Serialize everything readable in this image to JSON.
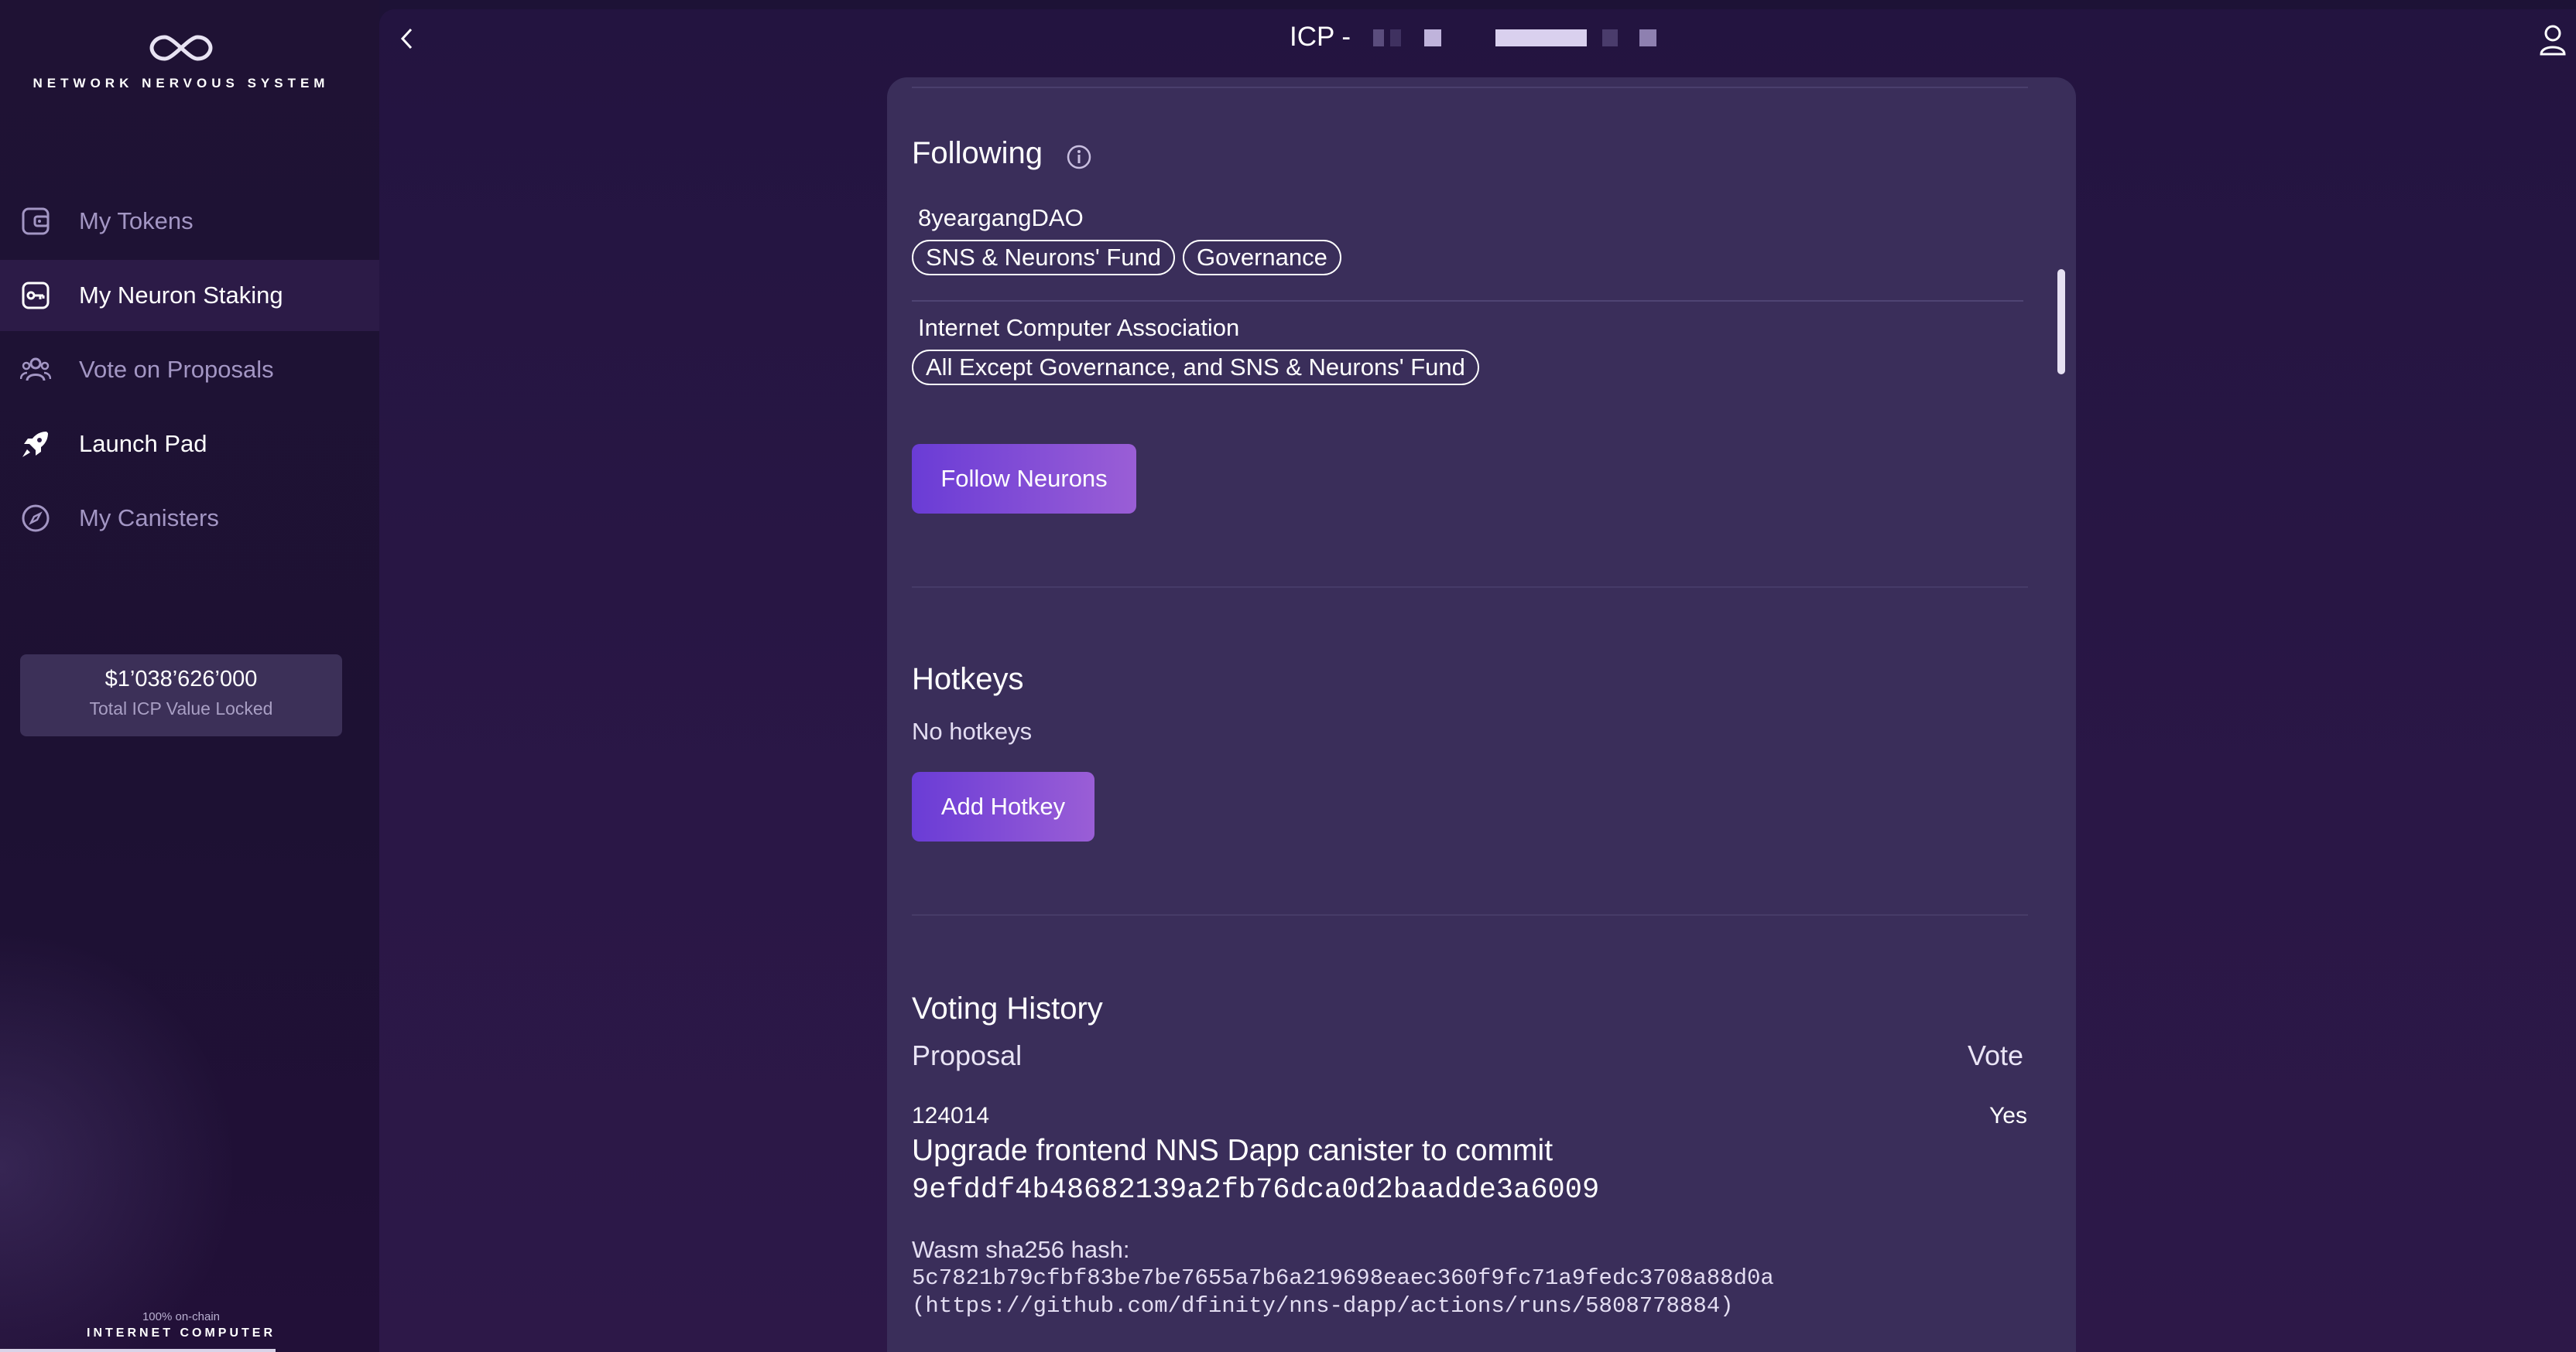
{
  "sidebar": {
    "logo_text": "NETWORK NERVOUS SYSTEM",
    "items": [
      {
        "label": "My Tokens",
        "icon": "wallet-icon"
      },
      {
        "label": "My Neuron Staking",
        "icon": "neuron-icon"
      },
      {
        "label": "Vote on Proposals",
        "icon": "users-icon"
      },
      {
        "label": "Launch Pad",
        "icon": "rocket-icon"
      },
      {
        "label": "My Canisters",
        "icon": "compass-icon"
      }
    ],
    "tvl": {
      "value": "$1’038’626’000",
      "label": "Total ICP Value Locked"
    },
    "footer": {
      "small": "100% on-chain",
      "big": "INTERNET COMPUTER"
    }
  },
  "header": {
    "title": "ICP -"
  },
  "following": {
    "title": "Following",
    "followees": [
      {
        "name": "8yeargangDAO",
        "topics": [
          "SNS & Neurons' Fund",
          "Governance"
        ]
      },
      {
        "name": "Internet Computer Association",
        "topics": [
          "All Except Governance, and SNS & Neurons' Fund"
        ]
      }
    ],
    "button": "Follow Neurons"
  },
  "hotkeys": {
    "title": "Hotkeys",
    "empty": "No hotkeys",
    "button": "Add Hotkey"
  },
  "voting_history": {
    "title": "Voting History",
    "col_proposal": "Proposal",
    "col_vote": "Vote",
    "rows": [
      {
        "id": "124014",
        "vote": "Yes",
        "title_line1": "Upgrade frontend NNS Dapp canister to commit",
        "title_line2": "9efddf4b48682139a2fb76dca0d2baadde3a6009",
        "hash_label": "Wasm sha256 hash:",
        "hash_value": "5c7821b79cfbf83be7be7655a7b6a219698eaec360f9fc71a9fedc3708a88d0a",
        "link": "(https://github.com/dfinity/nns-dapp/actions/runs/5808778884)"
      }
    ]
  }
}
